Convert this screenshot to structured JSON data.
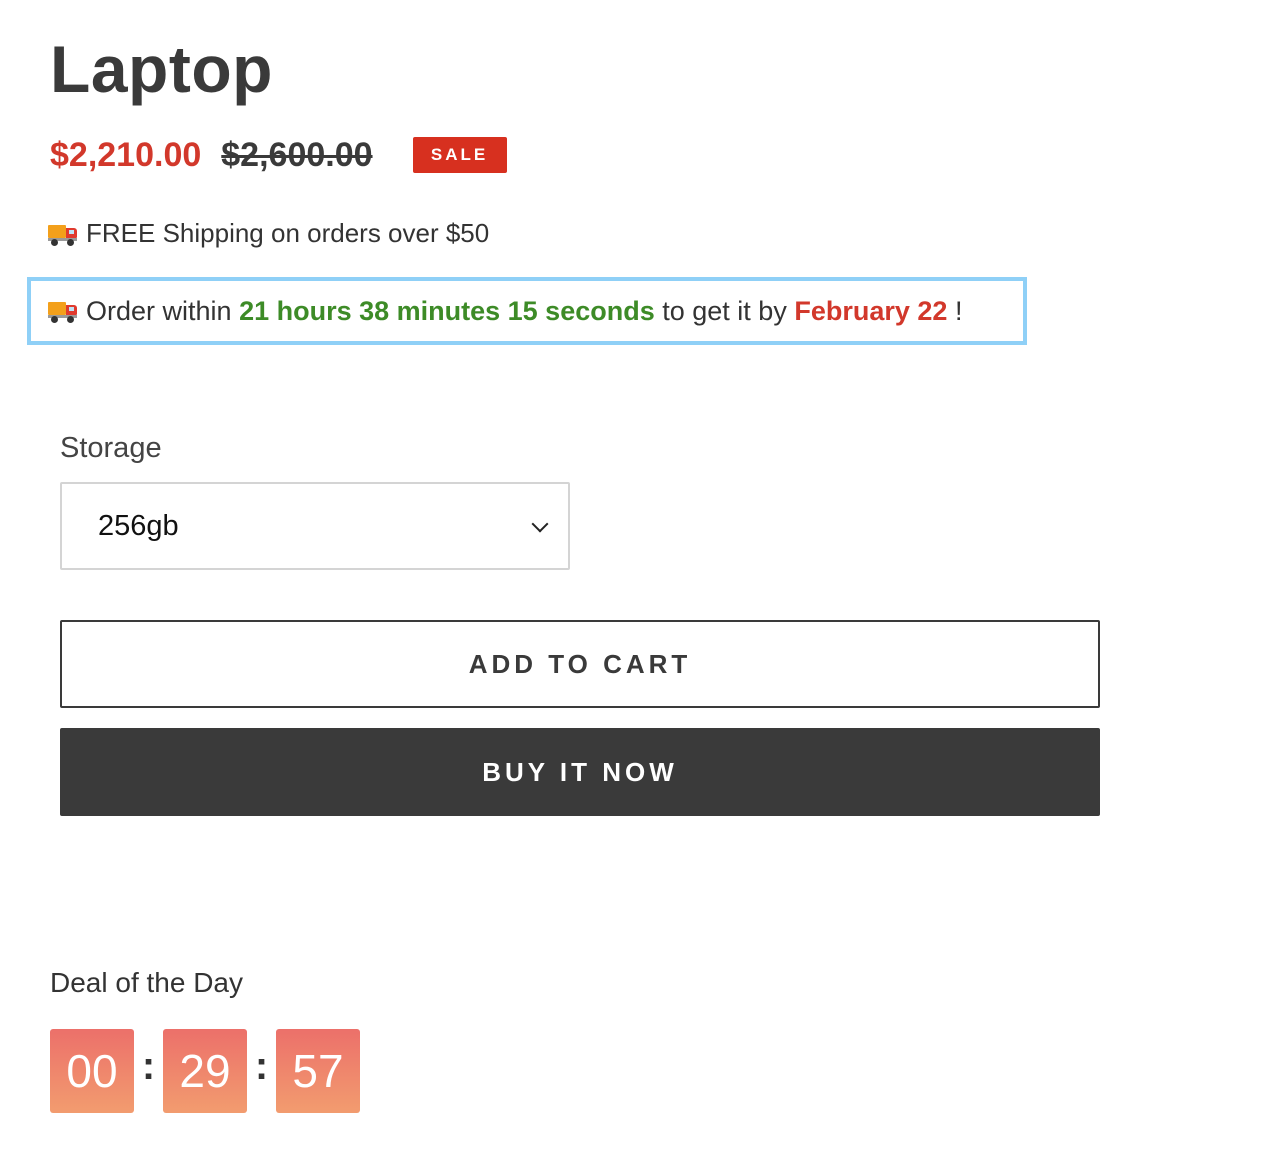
{
  "product": {
    "title": "Laptop",
    "price_sale": "$2,210.00",
    "price_compare": "$2,600.00",
    "sale_badge": "SALE"
  },
  "shipping": {
    "icon": "delivery-truck-icon",
    "text": "FREE Shipping on orders over $50"
  },
  "order_timer": {
    "icon": "delivery-truck-icon",
    "prefix": "Order within",
    "countdown": "21 hours 38 minutes 15 seconds",
    "middle": "to get it by",
    "date": "February 22",
    "suffix": "!",
    "highlight_color": "#8fd0f7"
  },
  "variant": {
    "label": "Storage",
    "selected": "256gb"
  },
  "actions": {
    "add_to_cart": "ADD TO CART",
    "buy_now": "BUY IT NOW"
  },
  "deal": {
    "label": "Deal of the Day",
    "hours": "00",
    "minutes": "29",
    "seconds": "57",
    "separator": ":"
  },
  "colors": {
    "sale_red": "#d2382b",
    "countdown_green": "#3d8b27",
    "dark_button": "#3a3a3a"
  }
}
